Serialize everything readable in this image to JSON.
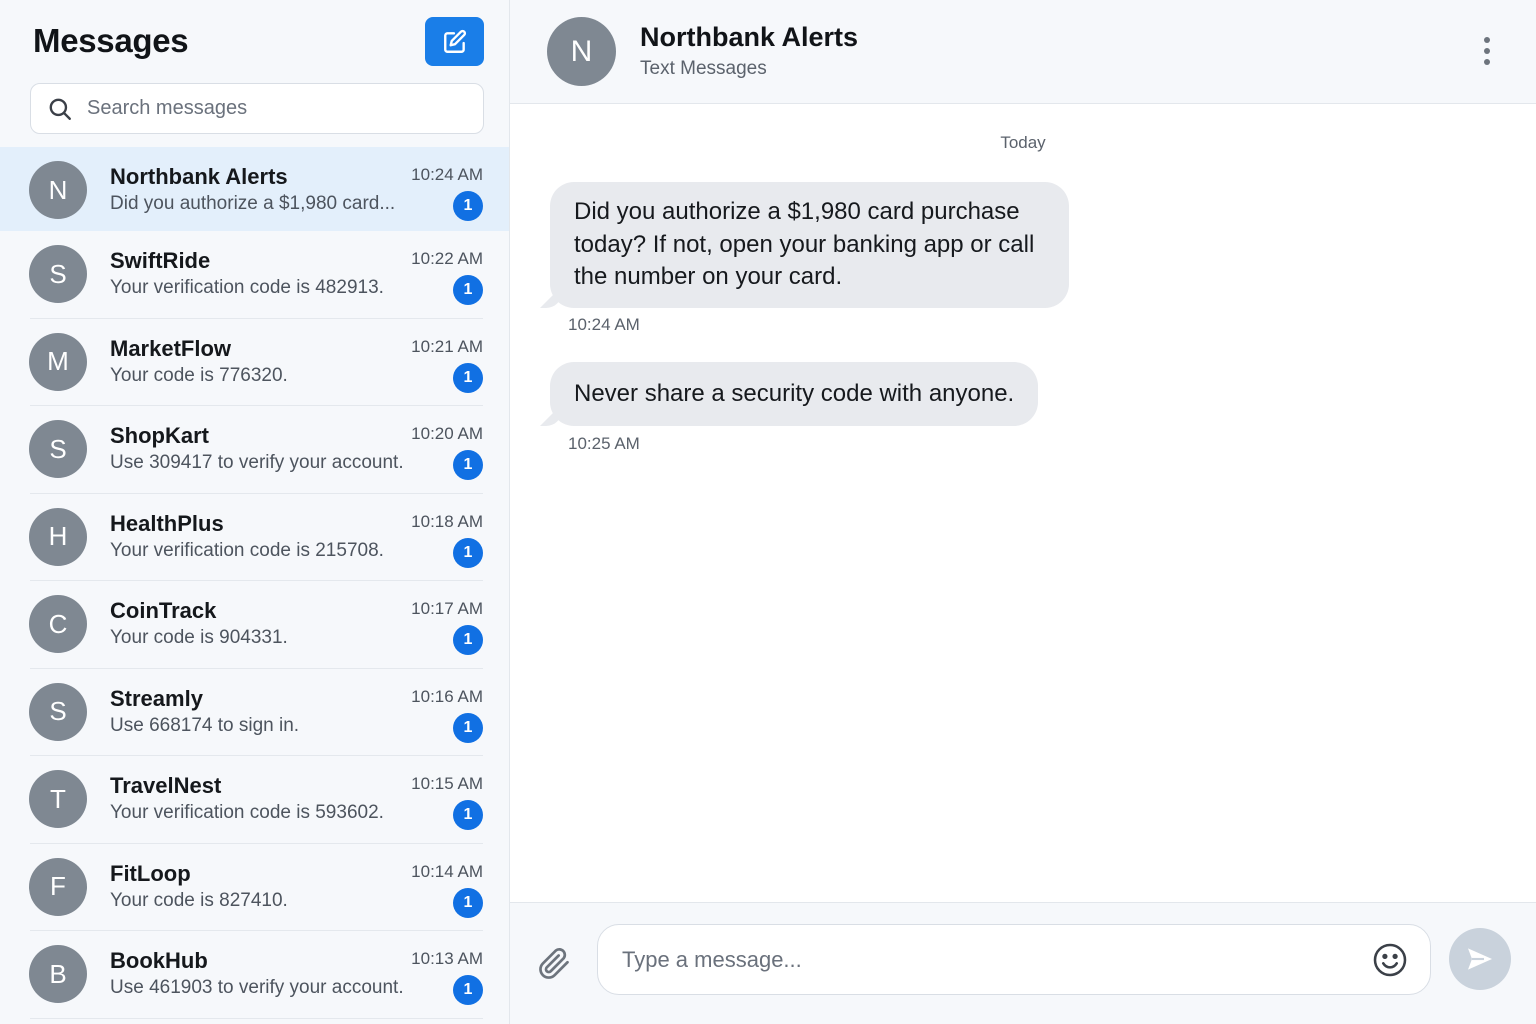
{
  "sidebar": {
    "title": "Messages",
    "compose_icon": "compose-icon",
    "search": {
      "placeholder": "Search messages",
      "icon": "search-icon"
    },
    "conversations": [
      {
        "initial": "N",
        "name": "Northbank Alerts",
        "preview": "Did you authorize a $1,980 card...",
        "time": "10:24 AM",
        "unread": "1",
        "active": true
      },
      {
        "initial": "S",
        "name": "SwiftRide",
        "preview": "Your verification code is 482913.",
        "time": "10:22 AM",
        "unread": "1"
      },
      {
        "initial": "M",
        "name": "MarketFlow",
        "preview": "Your code is 776320.",
        "time": "10:21 AM",
        "unread": "1"
      },
      {
        "initial": "S",
        "name": "ShopKart",
        "preview": "Use 309417 to verify your account.",
        "time": "10:20 AM",
        "unread": "1"
      },
      {
        "initial": "H",
        "name": "HealthPlus",
        "preview": "Your verification code is 215708.",
        "time": "10:18 AM",
        "unread": "1"
      },
      {
        "initial": "C",
        "name": "CoinTrack",
        "preview": "Your code is 904331.",
        "time": "10:17 AM",
        "unread": "1"
      },
      {
        "initial": "S",
        "name": "Streamly",
        "preview": "Use 668174 to sign in.",
        "time": "10:16 AM",
        "unread": "1"
      },
      {
        "initial": "T",
        "name": "TravelNest",
        "preview": "Your verification code is 593602.",
        "time": "10:15 AM",
        "unread": "1"
      },
      {
        "initial": "F",
        "name": "FitLoop",
        "preview": "Your code is 827410.",
        "time": "10:14 AM",
        "unread": "1"
      },
      {
        "initial": "B",
        "name": "BookHub",
        "preview": "Use 461903 to verify your account.",
        "time": "10:13 AM",
        "unread": "1"
      }
    ]
  },
  "chat": {
    "avatar_initial": "N",
    "name": "Northbank Alerts",
    "subtitle": "Text Messages",
    "day_label": "Today",
    "messages": [
      {
        "text": "Did you authorize a $1,980 card purchase today? If not, open your banking app or call the number on your card.",
        "time": "10:24 AM"
      },
      {
        "text": "Never share a security code with anyone.",
        "time": "10:25 AM"
      }
    ]
  },
  "composer": {
    "placeholder": "Type a message...",
    "attach_icon": "paperclip-icon",
    "emoji_icon": "smiley-icon",
    "send_icon": "send-icon"
  },
  "colors": {
    "accent": "#1a7ee8",
    "badge": "#1170e3",
    "avatar": "#7f8892",
    "active_row": "#e3effb",
    "bubble": "#e8eaee"
  }
}
